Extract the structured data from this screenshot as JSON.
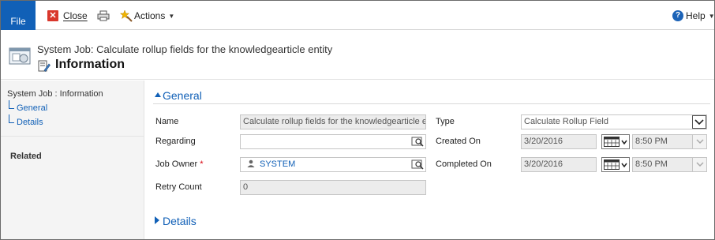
{
  "ribbon": {
    "file_label": "File",
    "close_label": "Close",
    "actions_label": "Actions",
    "help_label": "Help"
  },
  "header": {
    "entity_title": "System Job: Calculate rollup fields for the knowledgearticle entity",
    "form_title": "Information"
  },
  "nav": {
    "heading": "System Job : Information",
    "items": [
      {
        "label": "General"
      },
      {
        "label": "Details"
      }
    ],
    "related_label": "Related"
  },
  "general": {
    "section_label": "General",
    "name_label": "Name",
    "name_value": "Calculate rollup fields for the knowledgearticle e",
    "regarding_label": "Regarding",
    "regarding_value": "",
    "job_owner_label": "Job Owner",
    "required_mark": "*",
    "job_owner_value": "SYSTEM",
    "retry_count_label": "Retry Count",
    "retry_count_value": "0",
    "type_label": "Type",
    "type_value": "Calculate Rollup Field",
    "created_on_label": "Created On",
    "created_date": "3/20/2016",
    "created_time": "8:50 PM",
    "completed_on_label": "Completed On",
    "completed_date": "3/20/2016",
    "completed_time": "8:50 PM"
  },
  "details": {
    "section_label": "Details"
  },
  "colors": {
    "accent": "#1160b7",
    "close_red": "#d9372c",
    "required": "#d8000c"
  }
}
